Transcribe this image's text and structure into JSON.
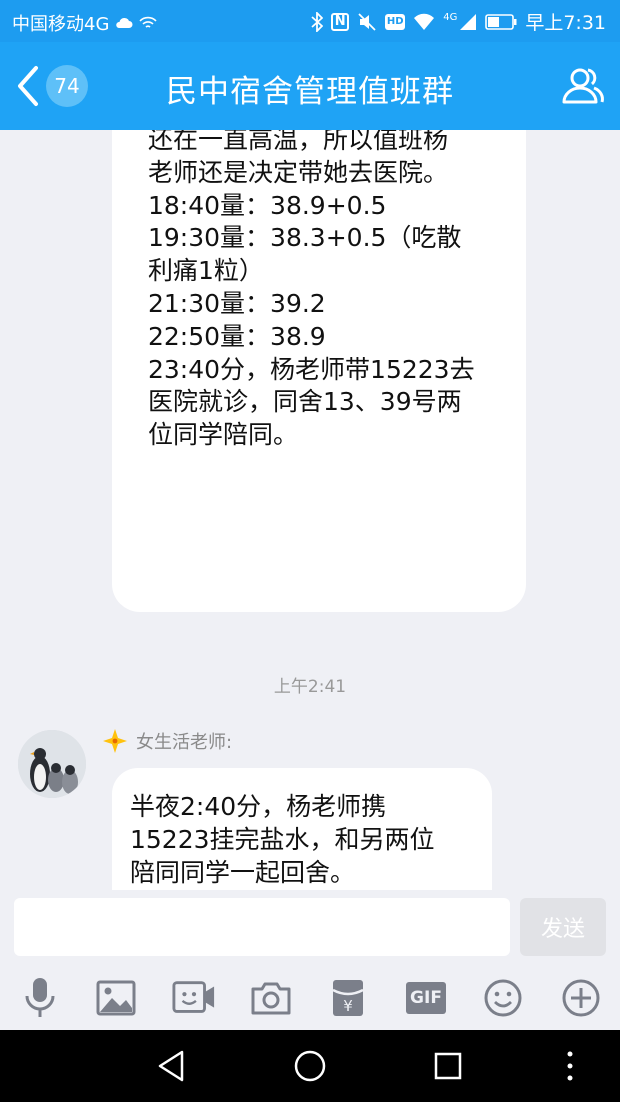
{
  "status_bar": {
    "carrier": "中国移动4G",
    "time": "早上7:31",
    "network": "4G",
    "hd": "HD",
    "nfc": "N"
  },
  "header": {
    "unread_badge": "74",
    "title": "民中宿舍管理值班群"
  },
  "messages": {
    "first": {
      "lines": [
        "还在一直高温，所以值班杨",
        "老师还是决定带她去医院。",
        "18:40量：38.9+0.5",
        "19:30量：38.3+0.5（吃散",
        "利痛1粒）",
        "21:30量：39.2",
        "22:50量：38.9",
        "23:40分，杨老师带15223去",
        "医院就诊，同舍13、39号两",
        "位同学陪同。"
      ]
    },
    "timestamp": "上午2:41",
    "second": {
      "sender": "女生活老师:",
      "lines": [
        "半夜2:40分，杨老师携",
        "15223挂完盐水，和另两位",
        "陪同同学一起回舍。"
      ]
    }
  },
  "input": {
    "value": "",
    "send_label": "发送"
  },
  "toolbar": {
    "gif_label": "GIF",
    "red_packet_symbol": "¥",
    "icons": [
      "microphone-icon",
      "image-icon",
      "video-call-icon",
      "camera-icon",
      "red-packet-icon",
      "gif-icon",
      "emoji-icon",
      "plus-icon"
    ]
  },
  "colors": {
    "header_blue": "#1fa3f5",
    "background": "#eff0f5",
    "bubble": "#ffffff",
    "icon_gray": "#7b7f8a"
  }
}
